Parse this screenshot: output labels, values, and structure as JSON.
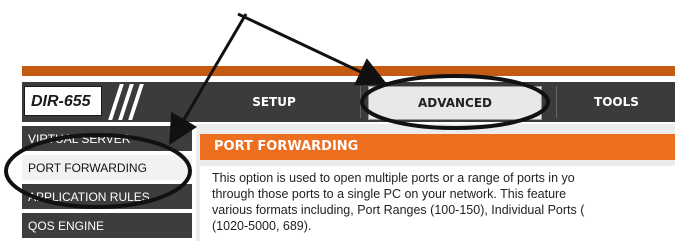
{
  "header": {
    "logo_text": "DIR-655",
    "tabs": [
      {
        "label": "SETUP"
      },
      {
        "label": "ADVANCED"
      },
      {
        "label": "TOOLS"
      }
    ]
  },
  "sidebar": {
    "items": [
      {
        "label": "VIRTUAL SERVER"
      },
      {
        "label": "PORT FORWARDING"
      },
      {
        "label": "APPLICATION RULES"
      },
      {
        "label": "QOS ENGINE"
      }
    ]
  },
  "content": {
    "heading": "PORT FORWARDING",
    "body": "This option is used to open multiple ports or a range of ports in yo\nthrough those ports to a single PC on your network. This feature\nvarious formats including, Port Ranges (100-150), Individual Ports (\n(1020-5000, 689)."
  },
  "colors": {
    "accent_orange": "#ee6e1f",
    "topbar": "#3b3b3b",
    "annotation": "#111111"
  }
}
